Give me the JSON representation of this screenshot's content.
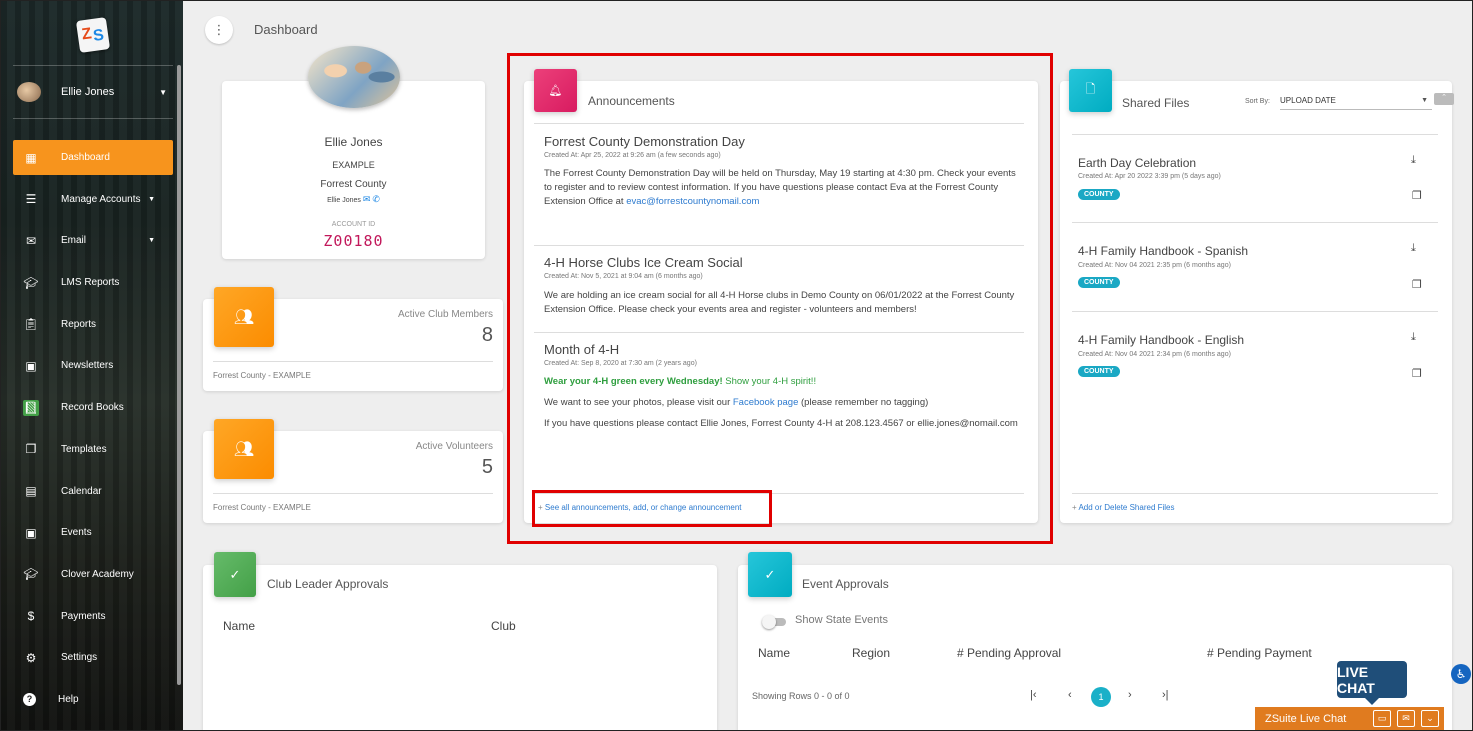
{
  "breadcrumb": "Dashboard",
  "user": {
    "name": "Ellie Jones"
  },
  "sidebar": {
    "items": [
      {
        "label": "Dashboard",
        "icon": "dashboard-icon",
        "active": true
      },
      {
        "label": "Manage Accounts",
        "icon": "list-icon",
        "caret": true
      },
      {
        "label": "Email",
        "icon": "mail-icon",
        "caret": true
      },
      {
        "label": "LMS Reports",
        "icon": "graduation-cap-icon"
      },
      {
        "label": "Reports",
        "icon": "clipboard-icon"
      },
      {
        "label": "Newsletters",
        "icon": "newsletter-icon"
      },
      {
        "label": "Record Books",
        "icon": "record-books-icon"
      },
      {
        "label": "Templates",
        "icon": "templates-icon"
      },
      {
        "label": "Calendar",
        "icon": "calendar-icon"
      },
      {
        "label": "Events",
        "icon": "event-icon"
      },
      {
        "label": "Clover Academy",
        "icon": "graduation-cap-icon"
      },
      {
        "label": "Payments",
        "icon": "dollar-icon"
      },
      {
        "label": "Settings",
        "icon": "gear-icon"
      },
      {
        "label": "Help",
        "icon": "help-icon"
      }
    ]
  },
  "profile": {
    "name": "Ellie Jones",
    "role": "EXAMPLE",
    "county": "Forrest County",
    "contact_name": "Ellie Jones",
    "account_id_label": "ACCOUNT ID",
    "account_id": "Z00180"
  },
  "stats": [
    {
      "label": "Active Club Members",
      "value": "8",
      "footer": "Forrest County - EXAMPLE"
    },
    {
      "label": "Active Volunteers",
      "value": "5",
      "footer": "Forrest County - EXAMPLE"
    }
  ],
  "announcements": {
    "title": "Announcements",
    "items": [
      {
        "title": "Forrest County Demonstration Day",
        "meta": "Created At: Apr 25, 2022 at 9:26 am (a few seconds ago)",
        "body": "The Forrest County Demonstration Day will be held on Thursday, May 19 starting at 4:30 pm. Check your events to register and to review contest information. If you have questions please contact Eva at the Forrest County Extension Office at",
        "email": "evac@forrestcountynomail.com"
      },
      {
        "title": "4-H Horse Clubs Ice Cream Social",
        "meta": "Created At: Nov 5, 2021 at 9:04 am (6 months ago)",
        "body": "We are holding an ice cream social for all 4-H Horse clubs in Demo County on 06/01/2022 at the Forrest County Extension Office. Please check your events area and register - volunteers and members!"
      },
      {
        "title": "Month of 4-H",
        "meta": "Created At: Sep 8, 2020 at 7:30 am (2 years ago)",
        "bold_green": "Wear your 4-H green every Wednesday!",
        "green": "Show your 4-H spirit!!",
        "line2_pre": "We want to see your photos, please visit our",
        "line2_link": "Facebook page",
        "line2_post": "(please remember no tagging)",
        "line3": "If you have questions please contact Ellie Jones, Forrest County 4-H at 208.123.4567 or ellie.jones@nomail.com"
      }
    ],
    "footer_link": "See all announcements, add, or change announcement"
  },
  "shared_files": {
    "title": "Shared Files",
    "sort_label": "Sort By:",
    "sort_value": "UPLOAD DATE",
    "items": [
      {
        "title": "Earth Day Celebration",
        "meta": "Created At: Apr 20 2022 3:39 pm (5 days ago)",
        "tag": "COUNTY"
      },
      {
        "title": "4-H Family Handbook - Spanish",
        "meta": "Created At: Nov 04 2021 2:35 pm (6 months ago)",
        "tag": "COUNTY"
      },
      {
        "title": "4-H Family Handbook - English",
        "meta": "Created At: Nov 04 2021 2:34 pm (6 months ago)",
        "tag": "COUNTY"
      }
    ],
    "footer_link": "Add or Delete Shared Files"
  },
  "club_leader": {
    "title": "Club Leader Approvals",
    "col_name": "Name",
    "col_club": "Club"
  },
  "event_approvals": {
    "title": "Event Approvals",
    "toggle_label": "Show State Events",
    "columns": [
      "Name",
      "Region",
      "# Pending Approval",
      "# Pending Payment"
    ],
    "showing": "Showing Rows 0 - 0 of 0",
    "page": "1"
  },
  "live_chat": {
    "badge": "LIVE CHAT",
    "bar_label": "ZSuite Live Chat"
  },
  "colors": {
    "sidebar_active": "#f7941d",
    "announcement_badge": "#e0316a",
    "files_badge": "#1ab0c8",
    "club_badge": "#4caf50",
    "event_badge": "#1ab0c8",
    "highlight": "#e00000"
  }
}
